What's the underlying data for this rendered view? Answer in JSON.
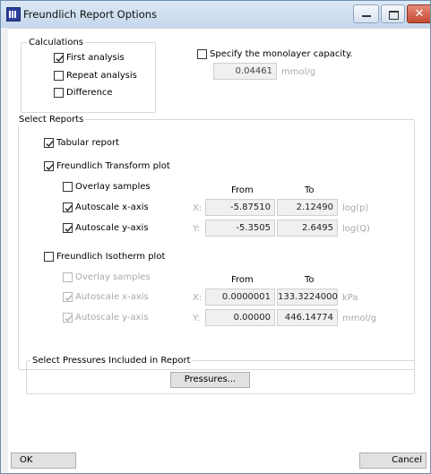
{
  "window": {
    "title": "Freundlich Report Options",
    "controls": [
      "minimize-icon",
      "maximize-icon",
      "close-icon"
    ],
    "close_glyph": "✕"
  },
  "calculations": {
    "legend": "Calculations",
    "first_analysis": {
      "label": "First analysis",
      "checked": true
    },
    "repeat_analysis": {
      "label": "Repeat analysis",
      "checked": false
    },
    "difference": {
      "label": "Difference",
      "checked": false
    }
  },
  "monolayer": {
    "label": "Specify the monolayer capacity.",
    "checked": false,
    "value": "0.04461",
    "unit": "mmol/g"
  },
  "reports": {
    "legend": "Select Reports",
    "tabular": {
      "label": "Tabular report",
      "checked": true
    },
    "transform": {
      "label": "Freundlich Transform plot",
      "checked": true,
      "overlay": {
        "label": "Overlay samples",
        "checked": false
      },
      "from_header": "From",
      "to_header": "To",
      "x": {
        "label": "Autoscale x-axis",
        "checked": true,
        "axis": "X:",
        "from": "-5.87510",
        "to": "2.12490",
        "unit": "log(p)"
      },
      "y": {
        "label": "Autoscale y-axis",
        "checked": true,
        "axis": "Y:",
        "from": "-5.3505",
        "to": "2.6495",
        "unit": "log(Q)"
      }
    },
    "isotherm": {
      "label": "Freundlich Isotherm plot",
      "checked": false,
      "overlay": {
        "label": "Overlay samples",
        "checked": false
      },
      "from_header": "From",
      "to_header": "To",
      "x": {
        "label": "Autoscale x-axis",
        "checked": true,
        "axis": "X:",
        "from": "0.0000001",
        "to": "133.3224000",
        "unit": "kPa"
      },
      "y": {
        "label": "Autoscale y-axis",
        "checked": true,
        "axis": "Y:",
        "from": "0.00000",
        "to": "446.14774",
        "unit": "mmol/g"
      }
    }
  },
  "pressures": {
    "legend": "Select Pressures Included in Report",
    "button": "Pressures..."
  },
  "footer": {
    "ok": "OK",
    "cancel": "Cancel"
  },
  "colors": {
    "check": "#222222",
    "check_disabled": "#b0b0b0",
    "close_button": "#c44a33"
  }
}
